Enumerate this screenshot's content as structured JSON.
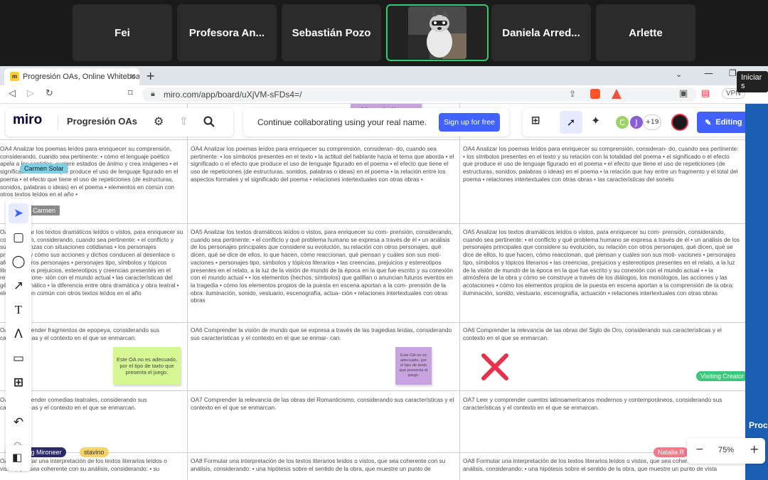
{
  "video": {
    "participants": [
      {
        "name": "Fei"
      },
      {
        "name": "Profesora An..."
      },
      {
        "name": "Sebastián Pozo"
      },
      {
        "name": ""
      },
      {
        "name": "Daniela Arred..."
      },
      {
        "name": "Arlette"
      }
    ],
    "tooltip": "Iniciar s"
  },
  "browser": {
    "tab_title": "Progresión OAs, Online Whiteboa",
    "url": "miro.com/app/board/uXjVM-sFDs4=/",
    "vpn_label": "VPN"
  },
  "miro": {
    "logo": "miro",
    "board_name": "Progresión OAs",
    "collab_message": "Continue collaborating using your real name.",
    "signup_label": "Sign up for free",
    "users_more": "+19",
    "editing_label": "Editing",
    "zoom_level": "75%",
    "avatar_c": "C",
    "avatar_j": "J"
  },
  "cursors": {
    "top_sticky": "Adecuando el juego y",
    "carmen_solar": "Carmen Solar",
    "carmen": "Carmen",
    "visiting_creator": "Visiting Creator",
    "visiting_mironeer": "ting Mironeer",
    "gustavo": "stavino",
    "natalia": "Natalia R",
    "prod": "Proc"
  },
  "rows": [
    {
      "c1": "OA4 Analizar los poemas leídos para enriquecer su comprensión, considerando, cuando sea pertinente: • cómo el lenguaje poético apela a los sentidos, sugiere estados de ánimo y crea imágenes • el significado o el efecto que produce el uso de lenguaje figurado en el poema • el efecto que tiene el uso de repeticiones (de estructuras, sonidos, palabras o ideas) en el poema • elementos en común con otros textos leídos en el año •",
      "c2": "OA4 Analizar los poemas leídos para enriquecer su comprensión, consideran- do, cuando sea pertinente: • los símbolos presentes en el texto • la actitud del hablante hacia el tema que aborda • el significado o el efecto que produce el uso de lenguaje figurado en el poema • el efecto que tiene el uso de repeticiones (de estructuras, sonidos, palabras o ideas) en el poema • la relación entre los aspectos formales y el significado del poema • relaciones intertextuales con otras obras •",
      "c3": "OA4 Analizar los poemas leídos para enriquecer su comprensión, consideran- do, cuando sea pertinente: • los símbolos presentes en el texto y su relación con la totalidad del poema • el significado o el efecto que produce el uso de lenguaje figurado en el poema • el efecto que tiene el uso de repeticiones (de estructuras, sonidos, palabras o ideas) en el poema • la relación que hay entre un fragmento y el total del poema • relaciones intertextuales con otras obras • las características del soneto"
    },
    {
      "c1": "OA5 Analizar los textos dramáticos leídos o vistos, para enriquecer su comprensión, considerando, cuando sea pertinente: • el conflicto y sus semejanzas con situaciones cotidianas • los personajes principales y cómo sus acciones y dichos conducen al desenlace o afectan a otros personajes • personajes tipo, símbolos y tópicos literarios • los prejuicios, estereotipos y creencias presentes en el relato y su cone- xión con el mundo actual • las características del género dramático • la diferencia entre obra dramática y obra teatral • elementos en común con otros textos leídos en el año",
      "c2": "OA5 Analizar los textos dramáticos leídos o vistos, para enriquecer su com- prensión, considerando, cuando sea pertinente: • el conflicto y qué problema humano se expresa a través de él • un análisis de los personajes principales que considere su evolución, su relación con otros personajes, qué dicen, qué se dice de ellos, lo que hacen, cómo reaccionan, qué piensan y cuáles son sus moti- vaciones • personajes tipo, símbolos y tópicos literarios • las creencias, prejuicios y estereotipos presentes en el relato, a la luz de la visión de mundo de la época en la que fue escrito y su conexión con el mundo actual • • los elementos (hechos, símbolos) que gatillan o anuncian futuros eventos en la tragedia • cómo los elementos propios de la puesta en escena aportan a la com- prensión de la obra: iluminación, sonido, vestuario, escenografía, actua- ción • relaciones intertextuales con otras obras",
      "c3": "OA5 Analizar los textos dramáticos leídos o vistos, para enriquecer su com- prensión, considerando, cuando sea pertinente: • el conflicto y qué problema humano se expresa a través de él • un análisis de los personajes principales que considere su evolución, su relación con otros personajes, qué dicen, qué se dice de ellos, lo que hacen, cómo reaccionan, qué piensan y cuáles son sus moti- vaciones • personajes tipo, símbolos y tópicos literarios • las creencias, prejuicios y estereotipos presentes en el relato, a la luz de la visión de mundo de la época en la que fue escrito y su conexión con el mundo actual • • la atmósfera de la obra y cómo se construye a través de los diálogos, los monólogos, las acciones y las acotaciones • cómo los elementos propios de la puesta en escena aportan a la comprensión de la obra: iluminación, sonido, vestuario, escenografía, actuación • relaciones intertextuales con otras obras"
    },
    {
      "c1": "OA6 Comprender fragmentos de epopeya, considerando sus características y el contexto en el que se enmarcan.",
      "c2": "OA6 Comprender la visión de mundo que se expresa a través de las tragedias leídas, considerando sus características y el contexto en el que se enmar- can.",
      "c3": "OA6 Comprender la relevancia de las obras del Siglo de Oro, considerando sus características y el contexto en el que se enmarcan."
    },
    {
      "c1": "OA7 Comprender comedias teatrales, considerando sus características y el contexto en el que se enmarcan.",
      "c2": "OA7 Comprender la relevancia de las obras del Romanticismo, considerando sus características y el contexto en el que se enmarcan.",
      "c3": "OA7 Leer y comprender cuentos latinoamericanos modernos y contemporáneos, considerando sus características y el contexto en el que se enmarcan."
    },
    {
      "c1": "OA8 Formular una interpretación de los textos literarios leídos o vistos, que sea coherente con su análisis, considerando: • su",
      "c2": "OA8 Formular una interpretación de los textos literarios leídos o vistos, que sea coherente con su análisis, considerando: • una hipótesis sobre el sentido de la obra, que muestre un punto de",
      "c3": "OA8 Formular una interpretación de los textos literarios leídos o vistos, que sea coherente con su análisis, considerando: • una hipótesis sobre el sentido de la obra, que muestre un punto de vista"
    }
  ],
  "stickies": {
    "green": "Este OA no es adecuado, por el tipo de taxto que presenta el juego.",
    "purple": "Este OA no es adecuado, por el tipo de texto que presenta el juego."
  },
  "colors": {
    "accent": "#4262ff",
    "active_tile": "#2cd06b",
    "sticky_green": "#d5f692",
    "sticky_purple": "#c9a3e0",
    "x_mark": "#e8304a"
  }
}
